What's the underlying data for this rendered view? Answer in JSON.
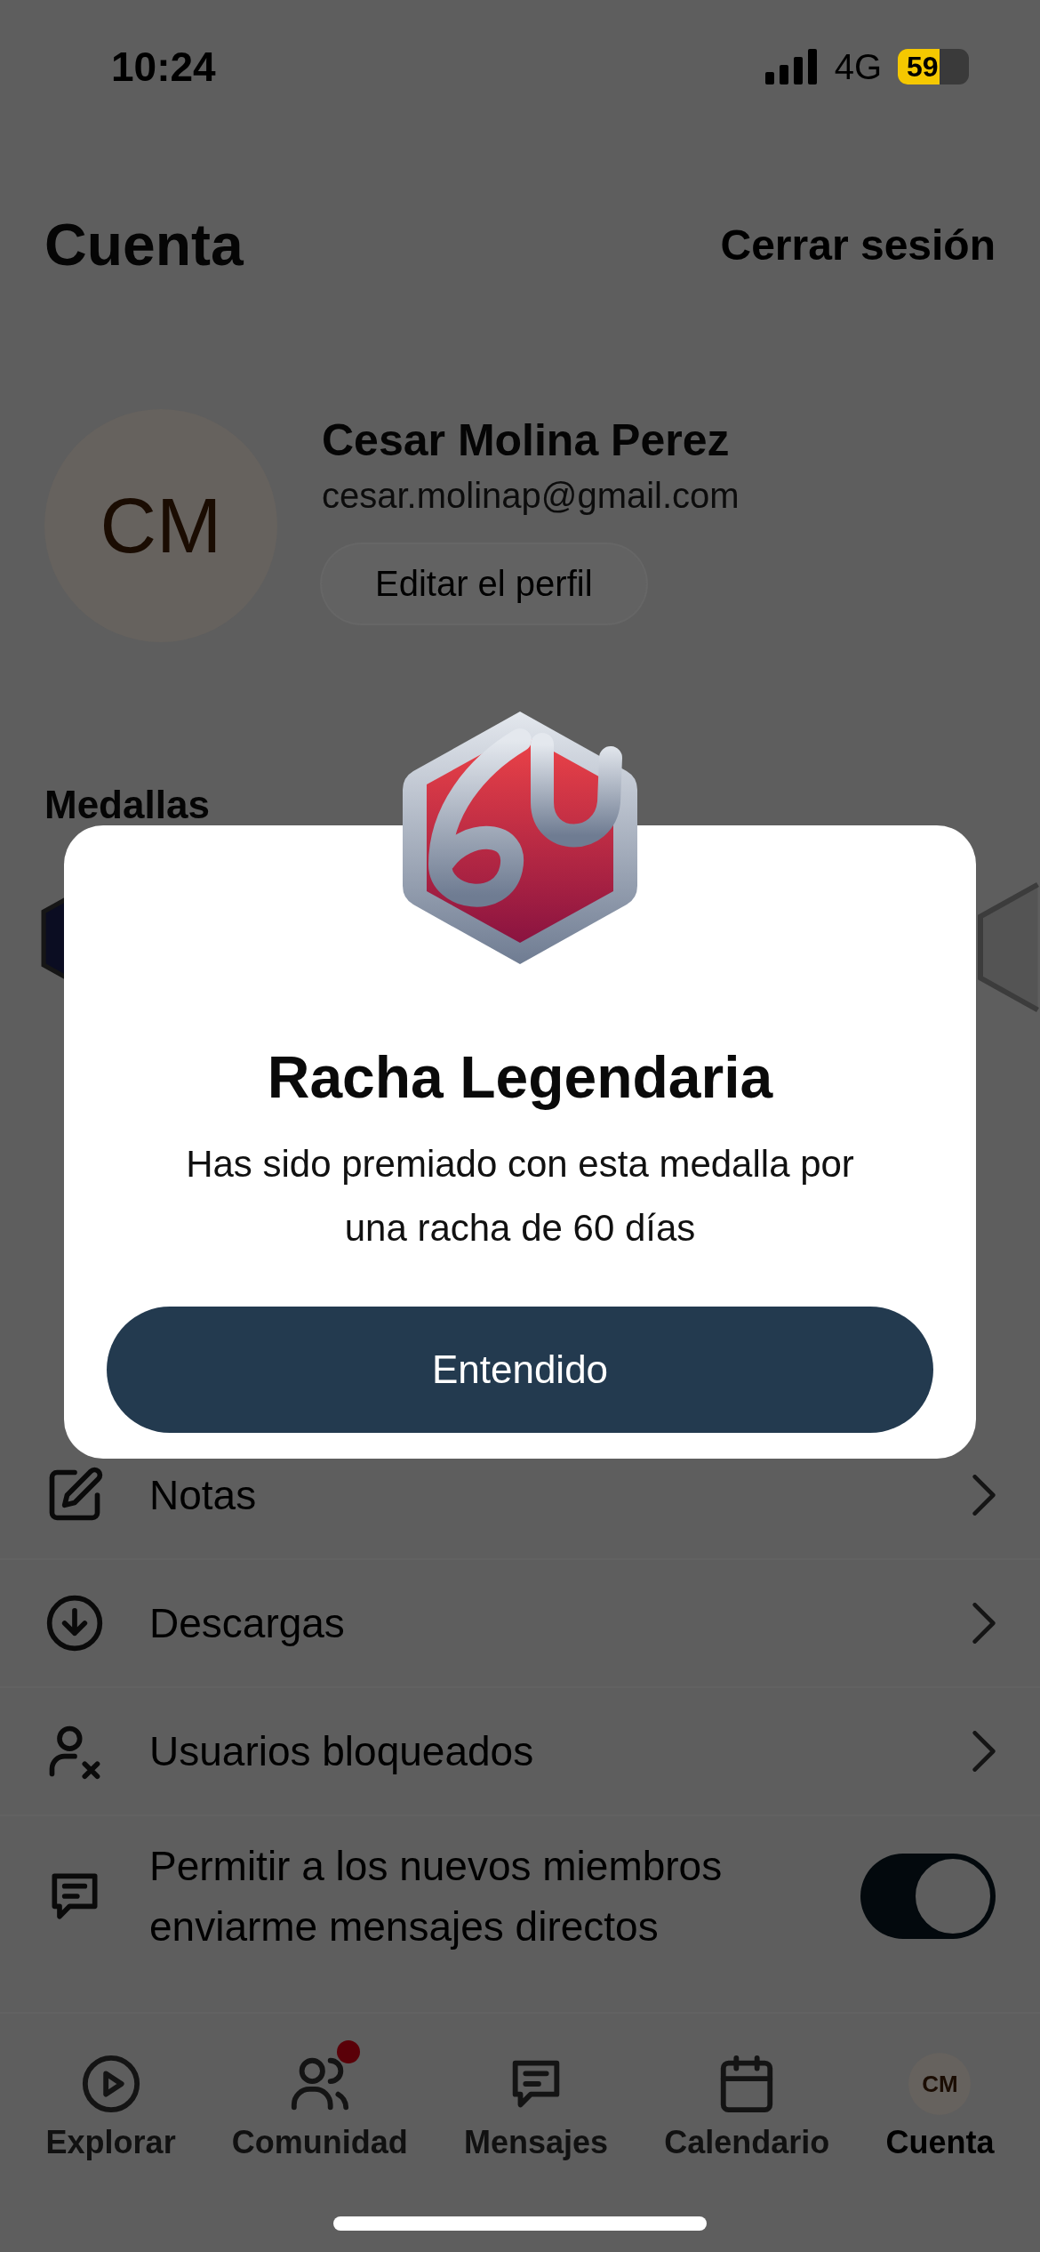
{
  "status_bar": {
    "time": "10:24",
    "network": "4G",
    "battery": "59"
  },
  "header": {
    "title": "Cuenta",
    "action": "Cerrar sesión"
  },
  "profile": {
    "initials": "CM",
    "name": "Cesar Molina Perez",
    "email": "cesar.molinap@gmail.com",
    "edit_button": "Editar el perfil"
  },
  "medals": {
    "title": "Medallas"
  },
  "menu": [
    {
      "label": "Notas",
      "kind": "link"
    },
    {
      "label": "Descargas",
      "kind": "link"
    },
    {
      "label": "Usuarios bloqueados",
      "kind": "link"
    },
    {
      "label": "Permitir a los nuevos miembros enviarme mensajes directos",
      "kind": "toggle",
      "on": true
    }
  ],
  "tab_bar": [
    {
      "label": "Explorar",
      "selected": false,
      "notification": false
    },
    {
      "label": "Comunidad",
      "selected": false,
      "notification": true
    },
    {
      "label": "Mensajes",
      "selected": false,
      "notification": false
    },
    {
      "label": "Calendario",
      "selected": false,
      "notification": false
    },
    {
      "label": "Cuenta",
      "selected": true,
      "notification": false,
      "initials": "CM"
    }
  ],
  "modal": {
    "title": "Racha Legendaria",
    "message": "Has sido premiado con esta medalla por una racha de 60 días",
    "button": "Entendido"
  }
}
